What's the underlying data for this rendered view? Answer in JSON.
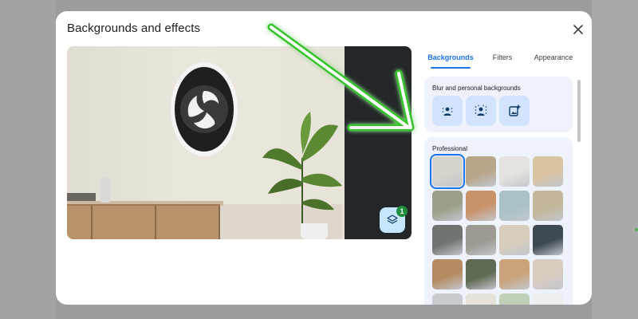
{
  "dialog": {
    "title": "Backgrounds and effects",
    "close_icon": "close-icon"
  },
  "preview": {
    "effects_badge": "1",
    "layers_icon": "layers-icon"
  },
  "tabs": [
    {
      "label": "Backgrounds",
      "active": true
    },
    {
      "label": "Filters",
      "active": false
    },
    {
      "label": "Appearance",
      "active": false
    }
  ],
  "blur_section": {
    "title": "Blur and personal backgrounds",
    "options": [
      "slight-blur-icon",
      "blur-icon",
      "upload-image-icon"
    ]
  },
  "professional_section": {
    "title": "Professional",
    "thumbnail_colors": [
      [
        "#d7d3cb",
        "#b8a68a",
        "#e5e3df",
        "#d9c3a3"
      ],
      [
        "#9aa08a",
        "#c9936a",
        "#a9c2c6",
        "#c2b79a"
      ],
      [
        "#6f7470",
        "#9c9a92",
        "#d7cdbd",
        "#3e4a52"
      ],
      [
        "#b58c62",
        "#5f6a54",
        "#caa37a",
        "#d8cbc0"
      ],
      [
        "#c8ccd0",
        "#e6e2da",
        "#bfcfb8",
        "#eeeeee"
      ]
    ]
  },
  "colors": {
    "accent": "#1a73e8",
    "badge": "#1e8e3e",
    "arrow_glow": "#34c32a"
  }
}
